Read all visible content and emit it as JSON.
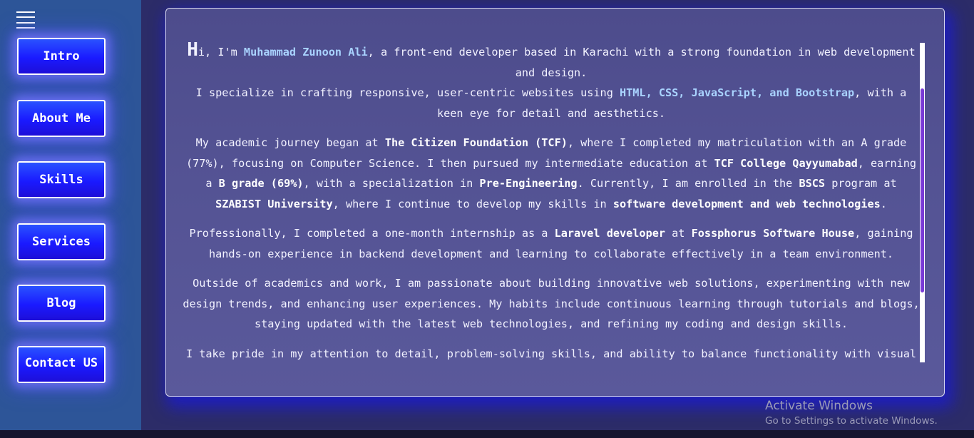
{
  "nav": {
    "items": [
      {
        "label": "Intro"
      },
      {
        "label": "About Me"
      },
      {
        "label": "Skills"
      },
      {
        "label": "Services"
      },
      {
        "label": "Blog"
      },
      {
        "label": "Contact US"
      }
    ]
  },
  "about": {
    "p1": {
      "dropcap": "H",
      "a": "i, I'm ",
      "name": "Muhammad Zunoon Ali",
      "b": ", a front-end developer based in Karachi with a strong foundation in web development and design.",
      "c": "I specialize in crafting responsive, user-centric websites using ",
      "skills": "HTML, CSS, JavaScript, and Bootstrap",
      "d": ", with a keen eye for detail and aesthetics."
    },
    "p2": {
      "a": "My academic journey began at ",
      "tcf": "The Citizen Foundation (TCF)",
      "b": ", where I completed my matriculation with an A grade (77%), focusing on Computer Science. I then pursued my intermediate education at ",
      "college": "TCF College Qayyumabad",
      "c": ", earning a ",
      "grade": "B grade (69%)",
      "d": ", with a specialization in ",
      "spec": "Pre-Engineering",
      "e": ". Currently, I am enrolled in the ",
      "prog": "BSCS",
      "f": " program at ",
      "uni": "SZABIST University",
      "g": ", where I continue to develop my skills in ",
      "focus": "software development and web technologies",
      "h": "."
    },
    "p3": {
      "a": "Professionally, I completed a one-month internship as a ",
      "role": "Laravel developer",
      "b": " at ",
      "company": "Fossphorus Software House",
      "c": ", gaining hands-on experience in backend development and learning to collaborate effectively in a team environment."
    },
    "p4": "Outside of academics and work, I am passionate about building innovative web solutions, experimenting with new design trends, and enhancing user experiences. My habits include continuous learning through tutorials and blogs, staying updated with the latest web technologies, and refining my coding and design skills.",
    "p5": "I take pride in my attention to detail, problem-solving skills, and ability to balance functionality with visual"
  },
  "watermark": {
    "line1": "Activate Windows",
    "line2": "Go to Settings to activate Windows."
  }
}
